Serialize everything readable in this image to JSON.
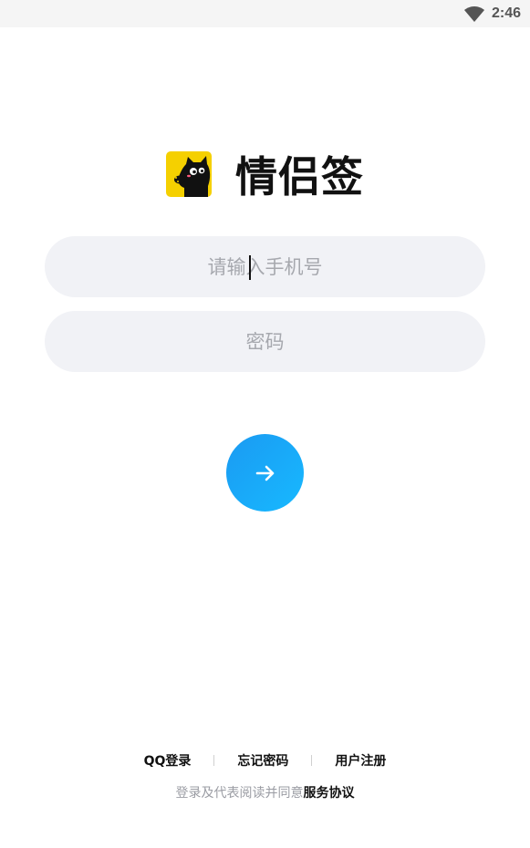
{
  "status_bar": {
    "time": "2:46",
    "icons": [
      "wifi-icon"
    ]
  },
  "brand": {
    "title": "情侣签",
    "logo_icon": "black-cat-logo-icon",
    "logo_bg": "#f5d000"
  },
  "form": {
    "phone_placeholder": "请输入手机号",
    "phone_value": "",
    "password_placeholder": "密码",
    "password_value": "",
    "submit_icon": "arrow-right-icon",
    "accent_color": "#1aa6f8"
  },
  "bottom_links": {
    "qq_login": "QQ登录",
    "forgot_password": "忘记密码",
    "register": "用户注册"
  },
  "agreement": {
    "prefix": "登录及代表阅读并同意",
    "link": "服务协议"
  }
}
